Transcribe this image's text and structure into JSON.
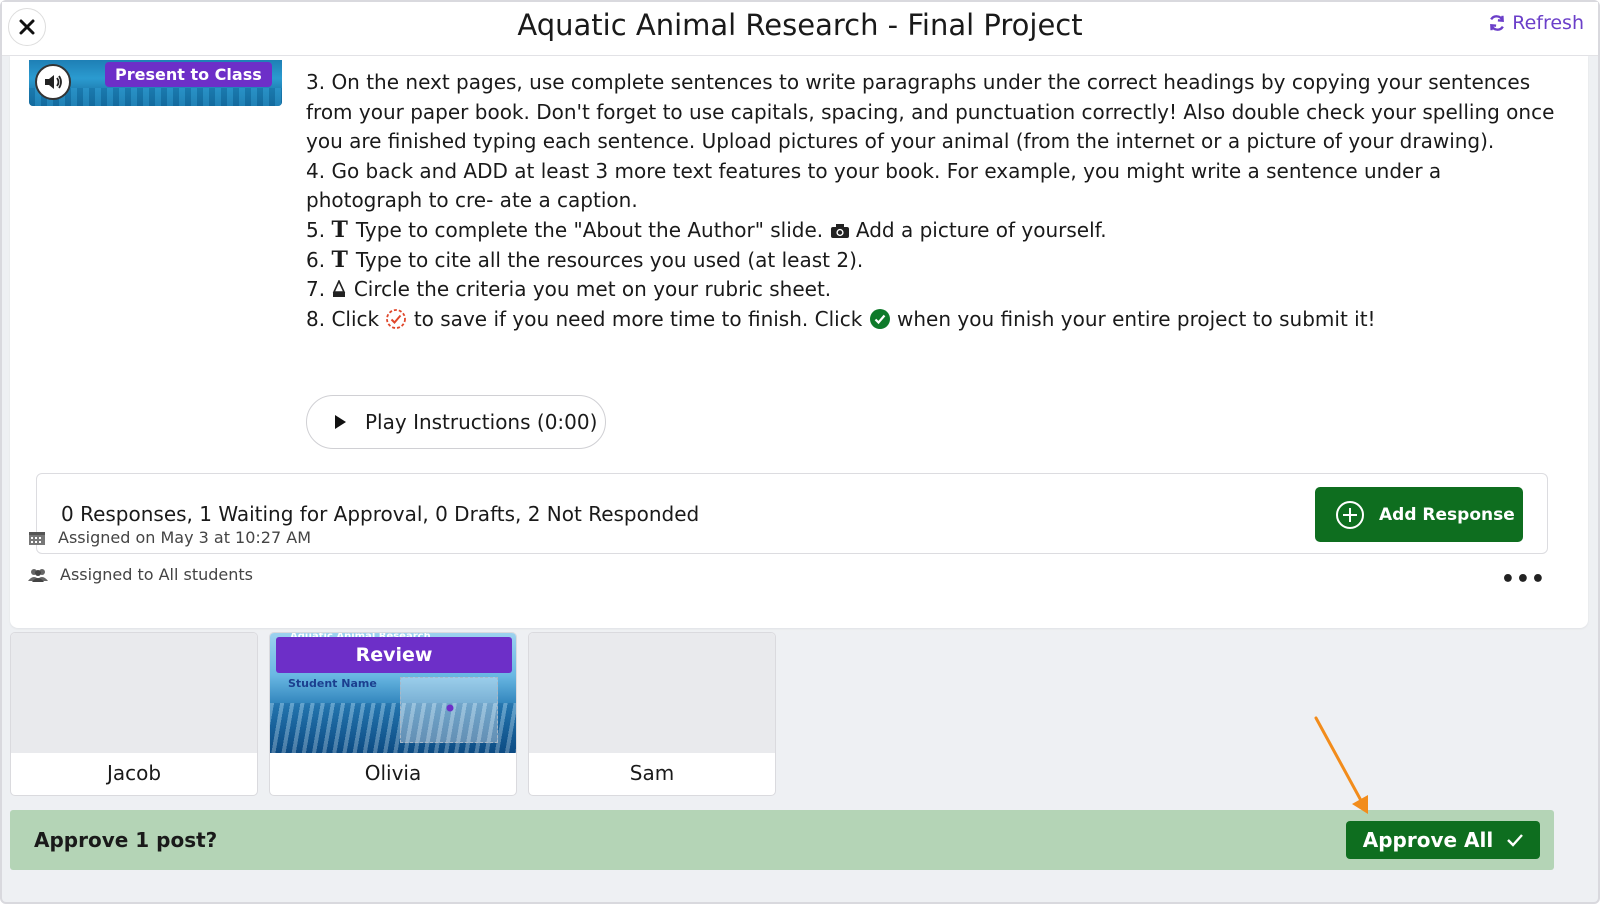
{
  "header": {
    "title": "Aquatic Animal Research - Final Project",
    "refresh_label": "Refresh"
  },
  "post_thumb": {
    "present_label": "Present to Class"
  },
  "instructions": {
    "items": [
      "3. On the next pages, use complete sentences to write paragraphs under the correct headings by copying your sentences from your paper book. Don't forget to use capitals, spacing, and punctuation correctly! Also double check your spelling once you are finished typing each sentence. Upload pictures of your animal (from the internet or a picture of your drawing).",
      "4. Go back and ADD at least 3 more text features to your book. For example, you might write a sentence under a photograph to cre- ate a caption."
    ],
    "step5_prefix": "5.",
    "step5_a": "Type to complete the \"About the Author\" slide.",
    "step5_b": "Add a picture of yourself.",
    "step6_prefix": "6.",
    "step6": "Type to cite all the resources you used (at least 2).",
    "step7_prefix": "7.",
    "step7": "Circle the criteria you met on your rubric sheet.",
    "step8_a": "8. Click",
    "step8_b": "to save if you need more time to finish. Click",
    "step8_c": "when you finish your entire project to submit it!",
    "play_label": "Play Instructions (0:00)"
  },
  "responses": {
    "summary": "0 Responses, 1 Waiting for Approval, 0 Drafts, 2 Not Responded",
    "add_label": "Add Response"
  },
  "meta": {
    "assigned_on": "Assigned on May 3 at 10:27 AM",
    "assigned_to": "Assigned to All students"
  },
  "students": [
    {
      "name": "Jacob"
    },
    {
      "name": "Olivia",
      "review_label": "Review",
      "slide_title": "Aquatic Animal Research",
      "slide_student": "Student Name"
    },
    {
      "name": "Sam"
    }
  ],
  "approve": {
    "question": "Approve 1 post?",
    "button_label": "Approve All"
  },
  "colors": {
    "accent_purple": "#6d2fc8",
    "primary_green": "#0e6e1f",
    "approve_bar": "#b4d4b6",
    "annotation_arrow": "#f28c1b"
  }
}
